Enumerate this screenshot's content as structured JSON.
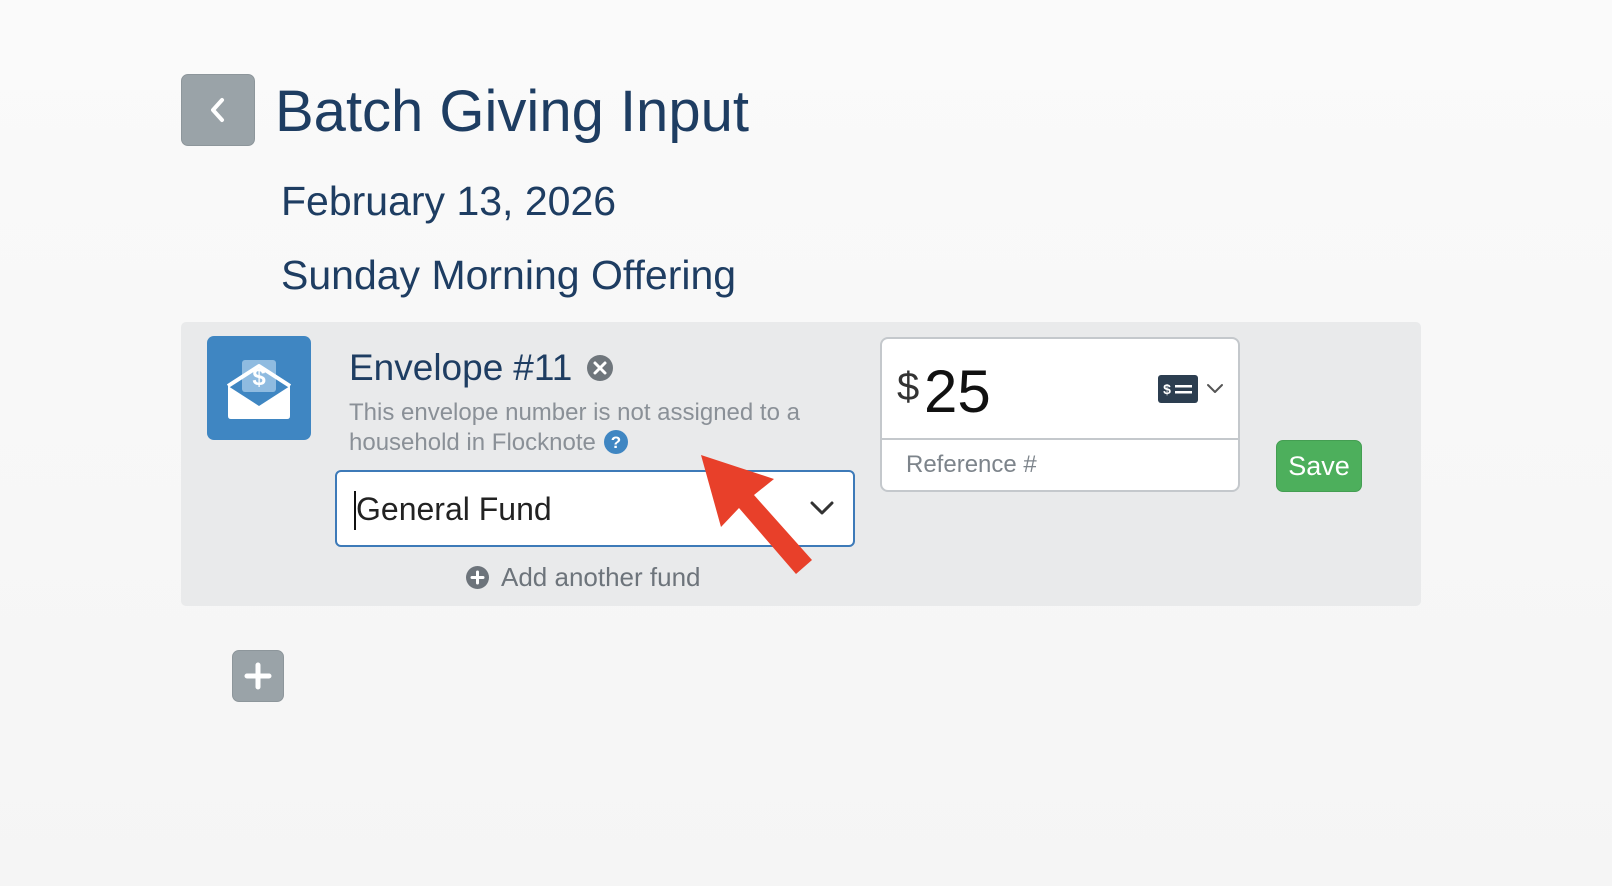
{
  "header": {
    "title": "Batch Giving Input",
    "back_icon": "chevron-left-icon"
  },
  "batch": {
    "date": "February 13, 2026",
    "name": "Sunday Morning Offering"
  },
  "entry": {
    "envelope_label": "Envelope",
    "envelope_number": "#11",
    "note": "This envelope number is not assigned to a household in Flocknote",
    "fund": {
      "selected": "General Fund"
    },
    "add_fund_label": "Add another fund",
    "amount": {
      "currency_symbol": "$",
      "value": "25"
    },
    "reference": {
      "placeholder": "Reference #"
    },
    "save_label": "Save"
  },
  "colors": {
    "title": "#1e3d62",
    "accent_blue": "#3f86c2",
    "save_green": "#4daf5c",
    "annotation_red": "#e8402a",
    "button_gray": "#9aa3a8"
  }
}
